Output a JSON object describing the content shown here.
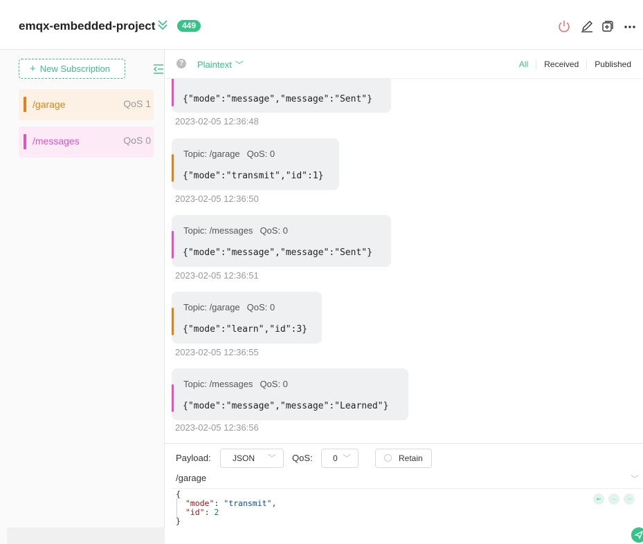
{
  "header": {
    "title": "emqx-embedded-project",
    "message_count": "449",
    "colors": {
      "accent": "#34c388",
      "disconnect": "#f56c6c"
    }
  },
  "left": {
    "new_subscription_label": "New Subscription",
    "subscriptions": [
      {
        "topic": "/garage",
        "qos": "QoS 1",
        "color": "#e08216",
        "bg": "#fdf1e5"
      },
      {
        "topic": "/messages",
        "qos": "QoS 0",
        "color": "#e052c0",
        "bg": "#fceaf7"
      }
    ]
  },
  "toolbar": {
    "format": "Plaintext",
    "tabs": [
      "All",
      "Received",
      "Published"
    ],
    "active_tab": "All"
  },
  "messages": [
    {
      "payload": "{\"mode\":\"message\",\"message\":\"Sent\"}",
      "time": "2023-02-05 12:36:48",
      "color": "#e052c0"
    },
    {
      "topic": "Topic: /garage",
      "qos": "QoS: 0",
      "payload": "{\"mode\":\"transmit\",\"id\":1}",
      "time": "2023-02-05 12:36:50",
      "color": "#e08216"
    },
    {
      "topic": "Topic: /messages",
      "qos": "QoS: 0",
      "payload": "{\"mode\":\"message\",\"message\":\"Sent\"}",
      "time": "2023-02-05 12:36:51",
      "color": "#e052c0"
    },
    {
      "topic": "Topic: /garage",
      "qos": "QoS: 0",
      "payload": "{\"mode\":\"learn\",\"id\":3}",
      "time": "2023-02-05 12:36:55",
      "color": "#e08216"
    },
    {
      "topic": "Topic: /messages",
      "qos": "QoS: 0",
      "payload": "{\"mode\":\"message\",\"message\":\"Learned\"}",
      "time": "2023-02-05 12:36:56",
      "color": "#e052c0"
    }
  ],
  "publish": {
    "payload_label": "Payload:",
    "payload_format": "JSON",
    "qos_label": "QoS:",
    "qos_value": "0",
    "retain_label": "Retain",
    "topic": "/garage",
    "editor": {
      "open": "{",
      "mode_key": "\"mode\"",
      "mode_value": "\"transmit\"",
      "id_key": "\"id\"",
      "id_value": "2",
      "close": "}"
    }
  }
}
